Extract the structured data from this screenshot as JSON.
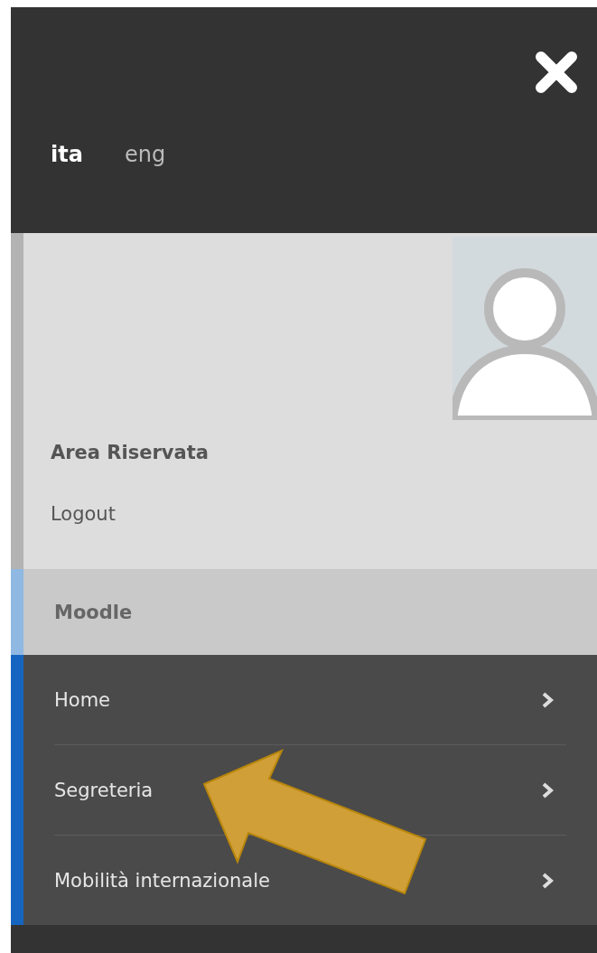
{
  "languages": [
    {
      "label": "ita",
      "selected": true
    },
    {
      "label": "eng",
      "selected": false
    }
  ],
  "profile": {
    "title": "Area Riservata",
    "logout": "Logout"
  },
  "section": {
    "title": "Moodle"
  },
  "menu": [
    {
      "label": "Home"
    },
    {
      "label": "Segreteria"
    },
    {
      "label": "Mobilità internazionale"
    }
  ]
}
